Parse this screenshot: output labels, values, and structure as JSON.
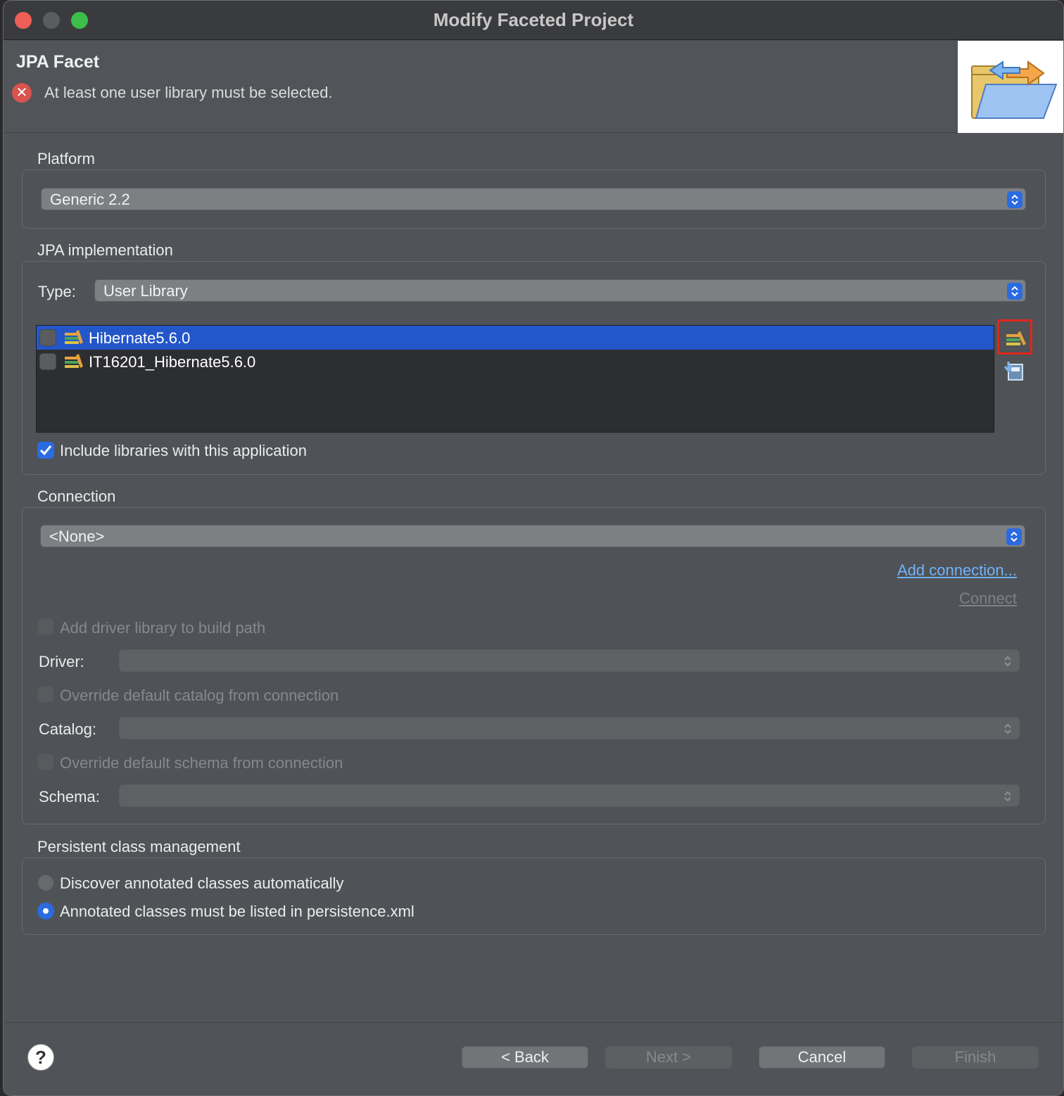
{
  "window": {
    "title": "Modify Faceted Project"
  },
  "header": {
    "title": "JPA Facet",
    "error_message": "At least one user library must be selected."
  },
  "platform": {
    "label": "Platform",
    "selected": "Generic 2.2"
  },
  "jpa_implementation": {
    "label": "JPA implementation",
    "type_label": "Type:",
    "type_selected": "User Library",
    "libraries": [
      {
        "name": "Hibernate5.6.0",
        "checked": false,
        "selected": true
      },
      {
        "name": "IT16201_Hibernate5.6.0",
        "checked": false,
        "selected": false
      }
    ],
    "include_libraries_label": "Include libraries with this application",
    "include_libraries_checked": true
  },
  "connection": {
    "label": "Connection",
    "selected": "<None>",
    "add_connection_link": "Add connection...",
    "connect_link": "Connect",
    "add_driver_label": "Add driver library to build path",
    "driver_label": "Driver:",
    "override_catalog_label": "Override default catalog from connection",
    "catalog_label": "Catalog:",
    "override_schema_label": "Override default schema from connection",
    "schema_label": "Schema:"
  },
  "persistent_class_management": {
    "label": "Persistent class management",
    "options": [
      {
        "label": "Discover annotated classes automatically",
        "selected": false
      },
      {
        "label": "Annotated classes must be listed in persistence.xml",
        "selected": true
      }
    ]
  },
  "footer": {
    "help": "?",
    "back": "< Back",
    "next": "Next >",
    "cancel": "Cancel",
    "finish": "Finish"
  },
  "colors": {
    "accent": "#2a6be0",
    "selection": "#2356c9",
    "error": "#d9534f",
    "highlight_box": "#e0271c",
    "link": "#6fb3ff"
  }
}
